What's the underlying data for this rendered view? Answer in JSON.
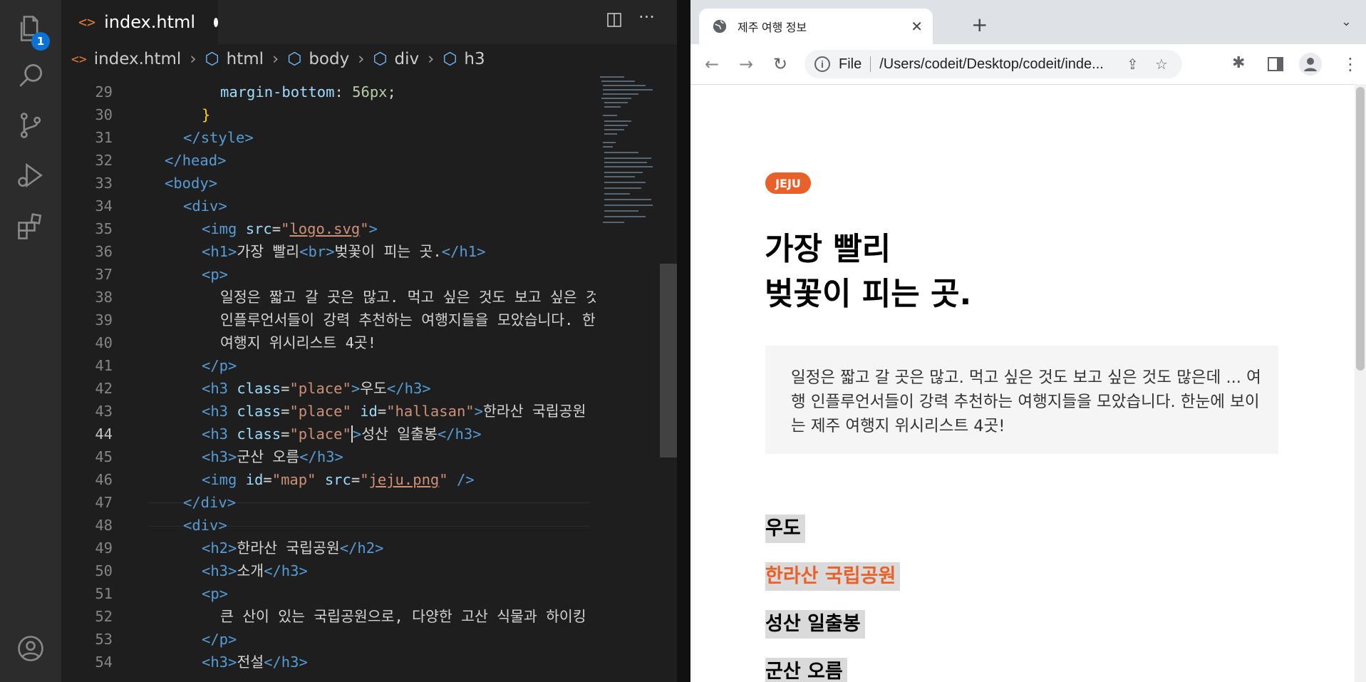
{
  "activity_bar": {
    "explorer_badge": "1",
    "items": [
      "explorer-icon",
      "search-icon",
      "source-control-icon",
      "run-debug-icon",
      "extensions-icon",
      "account-icon"
    ]
  },
  "editor": {
    "tab": {
      "name": "index.html"
    },
    "breadcrumb": [
      "index.html",
      "html",
      "body",
      "div",
      "h3"
    ],
    "lines": [
      {
        "n": "29"
      },
      {
        "n": "30"
      },
      {
        "n": "31"
      },
      {
        "n": "32"
      },
      {
        "n": "33"
      },
      {
        "n": "34"
      },
      {
        "n": "35"
      },
      {
        "n": "36"
      },
      {
        "n": "37"
      },
      {
        "n": "38"
      },
      {
        "n": "39"
      },
      {
        "n": "40"
      },
      {
        "n": "41"
      },
      {
        "n": "42"
      },
      {
        "n": "43"
      },
      {
        "n": "44"
      },
      {
        "n": "45"
      },
      {
        "n": "46"
      },
      {
        "n": "47"
      },
      {
        "n": "48"
      },
      {
        "n": "49"
      },
      {
        "n": "50"
      },
      {
        "n": "51"
      },
      {
        "n": "52"
      },
      {
        "n": "53"
      },
      {
        "n": "54"
      }
    ],
    "code": {
      "l29_prop": "margin-bottom",
      "l29_val": "56px",
      "l31": "style",
      "l32": "head",
      "l33": "body",
      "l34": "div",
      "l35_src": "logo.svg",
      "l36_text1": "가장 빨리",
      "l36_text2": "벚꽃이 피는 곳.",
      "l38": "일정은 짧고 갈 곳은 많고. 먹고 싶은 것도 보고 싶은 것",
      "l39": "인플루언서들이 강력 추천하는 여행지들을 모았습니다. 한",
      "l40": "여행지 위시리스트 4곳!",
      "l42_class": "\"place\"",
      "l42_text": "우도",
      "l43_id": "\"hallasan\"",
      "l43_text": "한라산 국립공원",
      "l44_text": "성산 일출봉",
      "l45_text": "군산 오름",
      "l46_id": "\"map\"",
      "l46_src": "jeju.png",
      "l49_text": "한라산 국립공원",
      "l50_text": "소개",
      "l52": "큰 산이 있는 국립공원으로, 다양한 고산 식물과 하이킹",
      "l54_text": "전설"
    }
  },
  "browser": {
    "tab_title": "제주 여행 정보",
    "omnibox_scheme": "File",
    "omnibox_url": "/Users/codeit/Desktop/codeit/inde...",
    "page": {
      "badge": "JEJU",
      "h1_line1": "가장 빨리",
      "h1_line2": "벚꽃이 피는 곳.",
      "paragraph": "일정은 짧고 갈 곳은 많고. 먹고 싶은 것도 보고 싶은 것도 많은데 ... 여행 인플루언서들이 강력 추천하는 여행지들을 모았습니다. 한눈에 보이는 제주 여행지 위시리스트 4곳!",
      "places": [
        "우도",
        "한라산 국립공원",
        "성산 일출봉",
        "군산 오름"
      ]
    },
    "accent_color": "#e9612a"
  }
}
